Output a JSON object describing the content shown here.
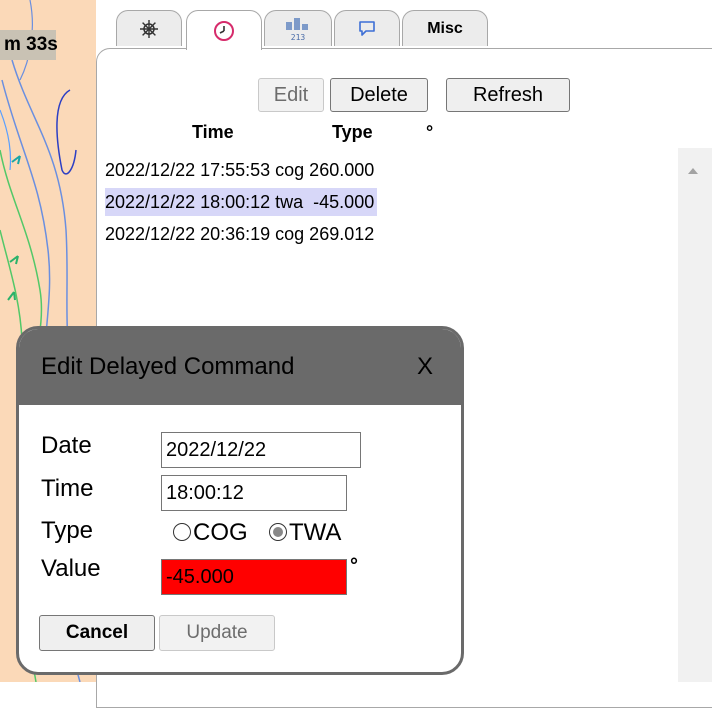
{
  "map": {
    "timer_text": "m 33s"
  },
  "tabs": [
    {
      "id": "wheel",
      "icon": "ship-wheel-icon",
      "active": false
    },
    {
      "id": "clock",
      "icon": "clock-icon",
      "active": true
    },
    {
      "id": "polar",
      "icon": "polar-chart-icon",
      "icon_text": "213",
      "active": false
    },
    {
      "id": "chat",
      "icon": "speech-bubble-icon",
      "active": false
    },
    {
      "id": "misc",
      "label": "Misc",
      "active": false
    }
  ],
  "toolbar": {
    "edit_label": "Edit",
    "delete_label": "Delete",
    "refresh_label": "Refresh"
  },
  "table": {
    "headers": {
      "time": "Time",
      "type": "Type",
      "value": "°"
    },
    "rows": [
      {
        "text": "2022/12/22 17:55:53 cog 260.000",
        "selected": false
      },
      {
        "text": "2022/12/22 18:00:12 twa  -45.000",
        "selected": true
      },
      {
        "text": "2022/12/22 20:36:19 cog 269.012",
        "selected": false
      }
    ]
  },
  "dialog": {
    "title": "Edit Delayed Command",
    "close_label": "X",
    "date_label": "Date",
    "date_value": "2022/12/22",
    "time_label": "Time",
    "time_value": "18:00:12",
    "type_label": "Type",
    "type_options": [
      "COG",
      "TWA"
    ],
    "type_selected": "TWA",
    "value_label": "Value",
    "value_value": "-45.000",
    "value_unit": "°",
    "cancel_label": "Cancel",
    "update_label": "Update"
  },
  "colors": {
    "selection": "#d7d7f8",
    "error_field": "#ff0000",
    "dialog_header": "#6a6a6a",
    "map_land": "#fbd9b8"
  }
}
